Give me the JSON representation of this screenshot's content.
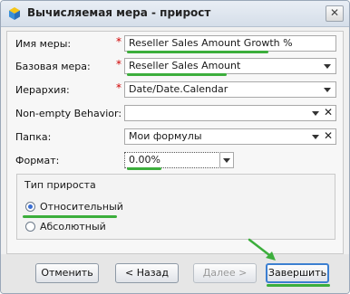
{
  "window": {
    "title": "Вычисляемая мера - прирост",
    "close_glyph": "✕"
  },
  "form": {
    "measure_name": {
      "label": "Имя меры:",
      "value": "Reseller Sales Amount Growth %"
    },
    "base_measure": {
      "label": "Базовая мера:",
      "value": "Reseller Sales Amount"
    },
    "hierarchy": {
      "label": "Иерархия:",
      "value": "Date/Date.Calendar"
    },
    "non_empty": {
      "label": "Non-empty Behavior:",
      "value": ""
    },
    "folder": {
      "label": "Папка:",
      "value": "Мои формулы"
    },
    "format": {
      "label": "Формат:",
      "value": "0.00%"
    },
    "required_mark": "*",
    "clear_glyph": "✕"
  },
  "growth_type": {
    "title": "Тип прироста",
    "options": [
      {
        "label": "Относительный",
        "checked": true
      },
      {
        "label": "Абсолютный",
        "checked": false
      }
    ]
  },
  "buttons": {
    "cancel": "Отменить",
    "back": "< Назад",
    "next": "Далее >",
    "finish": "Завершить"
  },
  "colors": {
    "highlight": "#3cae3c",
    "primary_border": "#3c7fd1",
    "required": "#d00000"
  }
}
